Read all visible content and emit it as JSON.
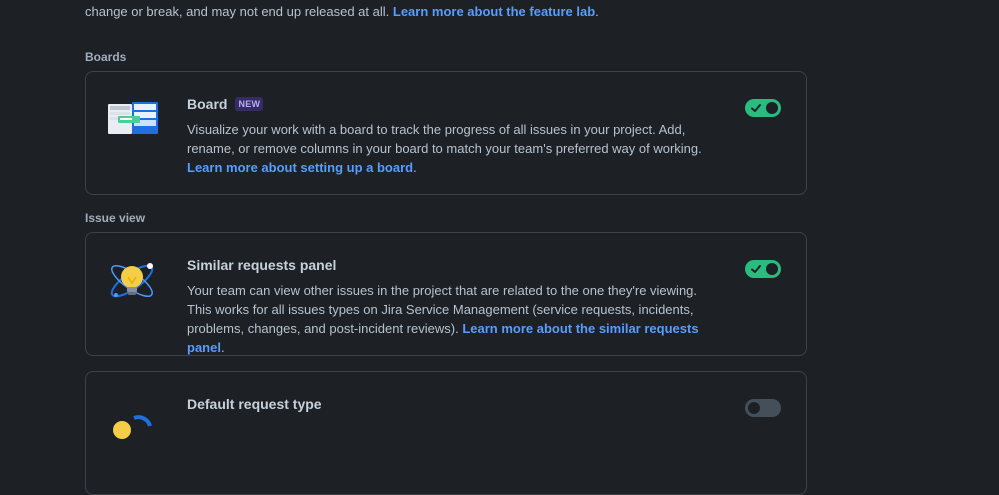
{
  "intro": {
    "text": "change or break, and may not end up released at all. ",
    "link": "Learn more about the feature lab",
    "after": "."
  },
  "sections": {
    "boards": {
      "heading": "Boards",
      "card": {
        "title": "Board",
        "badge": "NEW",
        "desc": "Visualize your work with a board to track the progress of all issues in your project. Add, rename, or remove columns in your board to match your team's preferred way of working.",
        "link": "Learn more about setting up a board",
        "after": ".",
        "toggle_on": true
      }
    },
    "issue_view": {
      "heading": "Issue view",
      "card": {
        "title": "Similar requests panel",
        "desc": "Your team can view other issues in the project that are related to the one they're viewing. This works for all issues types on Jira Service Management (service requests, incidents, problems, changes, and post-incident reviews). ",
        "link": "Learn more about the similar requests panel",
        "after": ".",
        "toggle_on": true
      },
      "partial_card": {
        "title": "Default request type",
        "toggle_on": false
      }
    }
  },
  "colors": {
    "background": "#1d2125",
    "link": "#579dff",
    "toggle_on": "#2abb7f",
    "badge_bg": "#352c63",
    "badge_text": "#b8acf6"
  },
  "icons": {
    "board_illustration": "board-illustration-icon",
    "similar_illustration": "lightbulb-orbit-icon",
    "default_illustration": "default-request-illustration-icon",
    "check": "check-icon"
  }
}
